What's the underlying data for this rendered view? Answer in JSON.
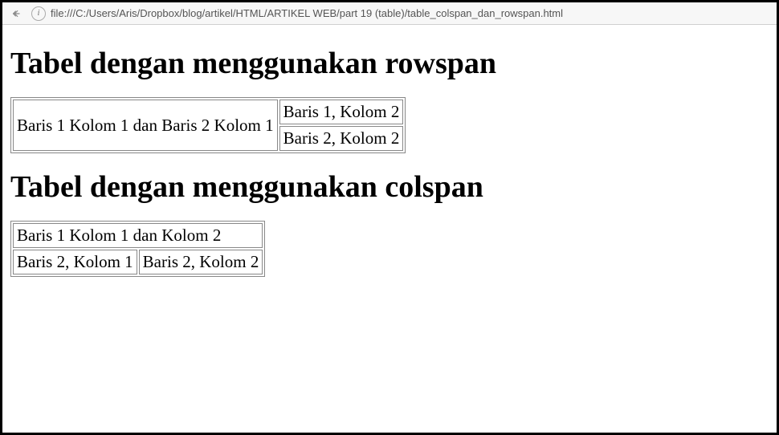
{
  "browser": {
    "url": "file:///C:/Users/Aris/Dropbox/blog/artikel/HTML/ARTIKEL WEB/part 19 (table)/table_colspan_dan_rowspan.html",
    "info_glyph": "i"
  },
  "page": {
    "heading_rowspan": "Tabel dengan menggunakan rowspan",
    "heading_colspan": "Tabel dengan menggunakan colspan",
    "rowspan_table": {
      "merged_cell": "Baris 1 Kolom 1 dan Baris 2 Kolom 1",
      "r1c2": "Baris 1, Kolom 2",
      "r2c2": "Baris 2, Kolom 2"
    },
    "colspan_table": {
      "merged_cell": "Baris 1 Kolom 1 dan Kolom 2",
      "r2c1": "Baris 2, Kolom 1",
      "r2c2": "Baris 2, Kolom 2"
    }
  }
}
